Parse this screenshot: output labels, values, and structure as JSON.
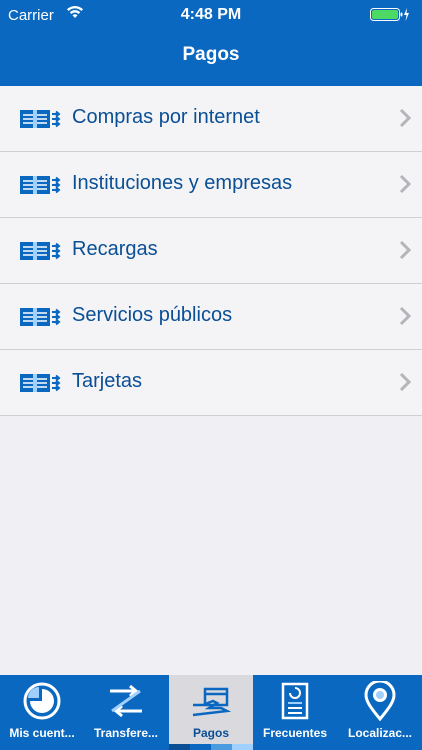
{
  "status_bar": {
    "carrier": "Carrier",
    "time": "4:48 PM"
  },
  "nav": {
    "title": "Pagos"
  },
  "menu": {
    "items": [
      {
        "label": "Compras por internet"
      },
      {
        "label": "Instituciones y empresas"
      },
      {
        "label": "Recargas"
      },
      {
        "label": "Servicios públicos"
      },
      {
        "label": "Tarjetas"
      }
    ]
  },
  "tabbar": {
    "tabs": [
      {
        "label": "Mis cuent...",
        "icon": "pie-chart-icon"
      },
      {
        "label": "Transfere...",
        "icon": "transfer-arrows-icon"
      },
      {
        "label": "Pagos",
        "icon": "payment-hand-icon",
        "active": true
      },
      {
        "label": "Frecuentes",
        "icon": "receipt-icon"
      },
      {
        "label": "Localizac...",
        "icon": "location-pin-icon"
      }
    ]
  },
  "colors": {
    "primary": "#0a68c0",
    "label_text": "#0a4f95",
    "background": "#efeff4",
    "active_tab": "#d9d9de"
  }
}
